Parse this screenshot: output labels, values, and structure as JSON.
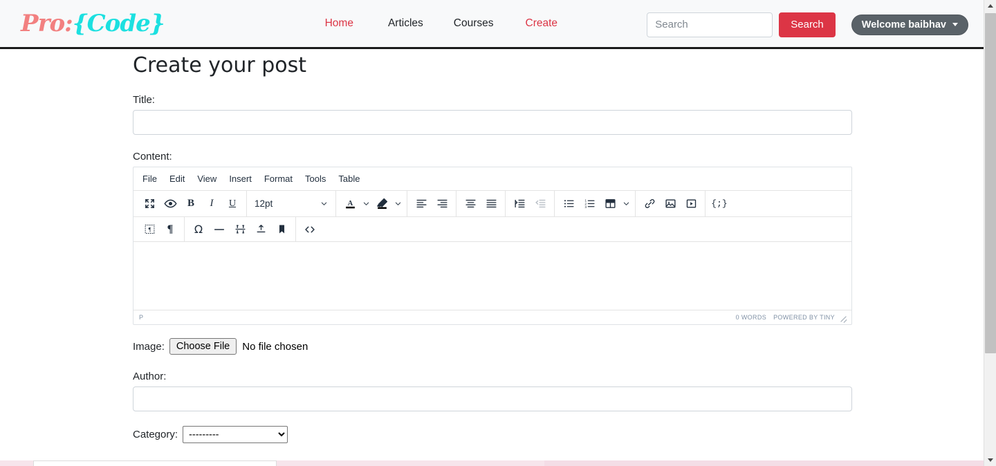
{
  "navbar": {
    "brand": {
      "prefix": "Pro:",
      "suffix": "{Code}",
      "color_prefix": "#f28080",
      "color_suffix": "#1ce0e0"
    },
    "links": [
      {
        "label": "Home",
        "accent": true
      },
      {
        "label": "Articles",
        "accent": false
      },
      {
        "label": "Courses",
        "accent": false
      },
      {
        "label": "Create",
        "accent": true
      }
    ],
    "search": {
      "value": "",
      "placeholder": "Search",
      "button_label": "Search",
      "button_color": "#dc3545"
    },
    "account": {
      "label": "Welcome baibhav",
      "chevron": "caret-down-icon",
      "color": "#5a6268"
    }
  },
  "page": {
    "title": "Create your post"
  },
  "form": {
    "title_label": "Title:",
    "title_value": "",
    "content_label": "Content:",
    "image_label": "Image:",
    "image_button": "Choose File",
    "image_status": "No file chosen",
    "author_label": "Author:",
    "author_value": "",
    "category_label": "Category:",
    "category_selected": "---------",
    "category_options": [
      "---------"
    ]
  },
  "editor": {
    "menubar": [
      "File",
      "Edit",
      "View",
      "Insert",
      "Format",
      "Tools",
      "Table"
    ],
    "toolbar_row1": [
      {
        "name": "fullscreen-icon",
        "group": 0,
        "disabled": false
      },
      {
        "name": "preview-eye-icon",
        "group": 0,
        "disabled": false
      },
      {
        "name": "bold-icon",
        "group": 0,
        "disabled": false
      },
      {
        "name": "italic-icon",
        "group": 0,
        "disabled": false
      },
      {
        "name": "underline-icon",
        "group": 0,
        "disabled": false
      }
    ],
    "fontsize_value": "12pt",
    "toolbar_row2": [
      {
        "name": "block-visual-icon"
      },
      {
        "name": "paragraph-mark-icon"
      },
      {
        "name": "special-character-icon"
      },
      {
        "name": "horizontal-rule-icon"
      },
      {
        "name": "page-break-icon"
      },
      {
        "name": "insert-template-icon"
      },
      {
        "name": "anchor-bookmark-icon"
      },
      {
        "name": "source-code-icon"
      }
    ],
    "content": "",
    "status": {
      "path": "P",
      "words": "0 WORDS",
      "branding": "POWERED BY TINY"
    }
  }
}
